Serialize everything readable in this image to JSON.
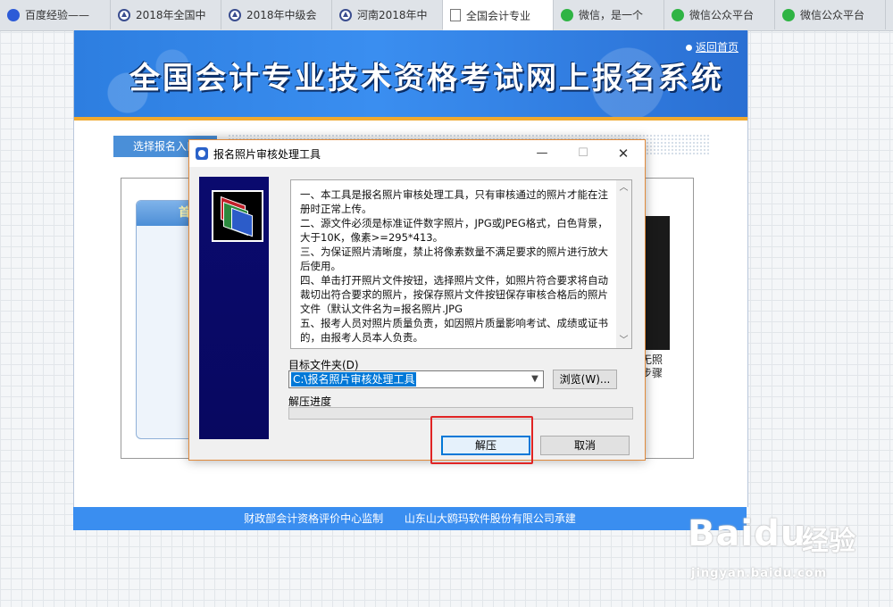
{
  "browser": {
    "tabs": [
      {
        "label": "百度经验——",
        "icon": "baidu-paw-icon",
        "active": false
      },
      {
        "label": "2018年全国中",
        "icon": "cpa-exam-icon",
        "active": false
      },
      {
        "label": "2018年中级会",
        "icon": "cpa-exam-icon",
        "active": false
      },
      {
        "label": "河南2018年中",
        "icon": "cpa-exam-icon",
        "active": false
      },
      {
        "label": "全国会计专业",
        "icon": "document-icon",
        "active": true
      },
      {
        "label": "微信，是一个",
        "icon": "wechat-icon",
        "active": false
      },
      {
        "label": "微信公众平台",
        "icon": "wechat-icon",
        "active": false
      },
      {
        "label": "微信公众平台",
        "icon": "wechat-icon",
        "active": false
      }
    ]
  },
  "site": {
    "title": "全国会计专业技术资格考试网上报名系统",
    "back_home": "返回首页",
    "step_tab": "选择报名入口",
    "panel_head": "首",
    "photo_note_line1": "无照",
    "photo_note_line2": "步骤",
    "footer_left": "财政部会计资格评价中心监制",
    "footer_right": "山东山大鸥玛软件股份有限公司承建"
  },
  "dialog": {
    "title": "报名照片审核处理工具",
    "minimize": "—",
    "maximize": "☐",
    "close": "✕",
    "notice_lines": [
      "一、本工具是报名照片审核处理工具，只有审核通过的照片才能在注册时正常上传。",
      "二、源文件必须是标准证件数字照片，JPG或JPEG格式，白色背景，大于10K，像素>=295*413。",
      "三、为保证照片清晰度，禁止将像素数量不满足要求的照片进行放大后使用。",
      "四、单击打开照片文件按钮，选择照片文件，如照片符合要求将自动裁切出符合要求的照片，按保存照片文件按钮保存审核合格后的照片文件（默认文件名为=报名照片.JPG",
      "五、报考人员对照片质量负责，如因照片质量影响考试、成绩或证书的，由报考人员本人负责。"
    ],
    "target_folder_label": "目标文件夹(D)",
    "target_folder_value": "C:\\报名照片审核处理工具",
    "browse_label": "浏览(W)...",
    "progress_label": "解压进度",
    "progress_value": 0,
    "extract_label": "解压",
    "cancel_label": "取消"
  },
  "watermark": {
    "logo": "Baidu",
    "suffix": "经验",
    "url": "jingyan.baidu.com"
  },
  "colors": {
    "accent": "#3a8ef0",
    "highlight": "#e02424",
    "dialog_border": "#e08a3c"
  }
}
